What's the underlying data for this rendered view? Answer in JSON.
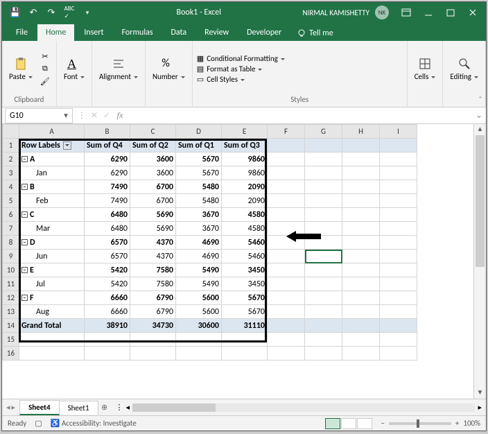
{
  "window": {
    "title": "Book1 - Excel",
    "user": "NIRMAL KAMISHETTY",
    "initials": "NK"
  },
  "tabs": {
    "file": "File",
    "home": "Home",
    "insert": "Insert",
    "formulas": "Formulas",
    "data": "Data",
    "review": "Review",
    "developer": "Developer",
    "tellme": "Tell me"
  },
  "ribbon": {
    "clipboard": {
      "label": "Clipboard",
      "paste": "Paste"
    },
    "font": {
      "label": "Font",
      "btn": "Font"
    },
    "alignment": {
      "label": "Alignment",
      "btn": "Alignment"
    },
    "number": {
      "label": "Number",
      "btn": "Number"
    },
    "styles": {
      "label": "Styles",
      "cond": "Conditional Formatting",
      "table": "Format as Table",
      "cell": "Cell Styles"
    },
    "cells": {
      "label": "Cells",
      "btn": "Cells"
    },
    "editing": {
      "label": "Editing",
      "btn": "Editing"
    }
  },
  "namebox": "G10",
  "columns": [
    "A",
    "B",
    "C",
    "D",
    "E",
    "F",
    "G",
    "H",
    "I"
  ],
  "pivot": {
    "rowlabel_hdr": "Row Labels",
    "val_hdrs": [
      "Sum of Q4",
      "Sum of Q2",
      "Sum of Q1",
      "Sum of Q3"
    ],
    "groups": [
      {
        "key": "A",
        "child": "Jan",
        "vals": [
          6290,
          3600,
          5670,
          9860
        ],
        "childvals": [
          6290,
          3600,
          5670,
          9860
        ]
      },
      {
        "key": "B",
        "child": "Feb",
        "vals": [
          7490,
          6700,
          5480,
          2090
        ],
        "childvals": [
          7490,
          6700,
          5480,
          2090
        ]
      },
      {
        "key": "C",
        "child": "Mar",
        "vals": [
          6480,
          5690,
          3670,
          4580
        ],
        "childvals": [
          6480,
          5690,
          3670,
          4580
        ]
      },
      {
        "key": "D",
        "child": "Jun",
        "vals": [
          6570,
          4370,
          4690,
          5460
        ],
        "childvals": [
          6570,
          4370,
          4690,
          5460
        ]
      },
      {
        "key": "E",
        "child": "Jul",
        "vals": [
          5420,
          7580,
          5490,
          3450
        ],
        "childvals": [
          5420,
          7580,
          5490,
          3450
        ]
      },
      {
        "key": "F",
        "child": "Aug",
        "vals": [
          6660,
          6790,
          5600,
          5670
        ],
        "childvals": [
          6660,
          6790,
          5600,
          5670
        ]
      }
    ],
    "grand_label": "Grand Total",
    "grand_vals": [
      38910,
      34730,
      30600,
      31110
    ]
  },
  "sheets": {
    "active": "Sheet4",
    "other": "Sheet1"
  },
  "status": {
    "ready": "Ready",
    "acc": "Accessibility: Investigate",
    "zoom": "100%"
  }
}
